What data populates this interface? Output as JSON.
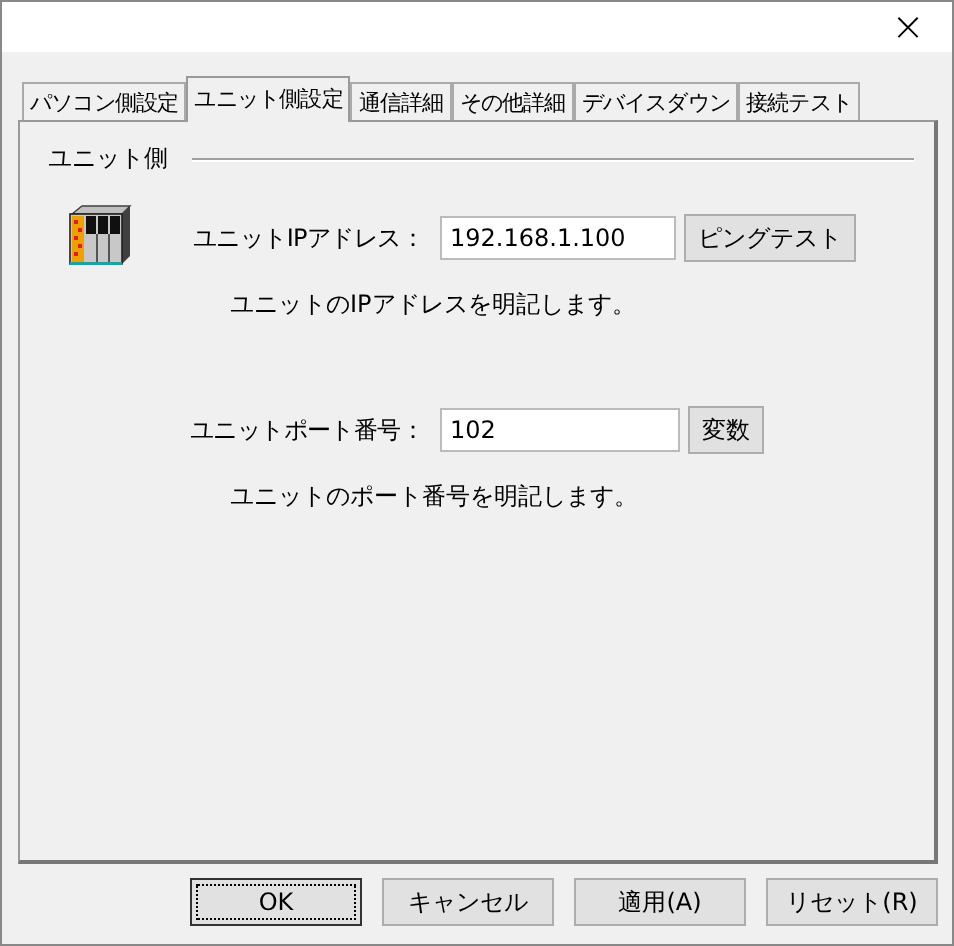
{
  "window": {
    "close": "×"
  },
  "tabs": [
    {
      "label": "パソコン側設定",
      "selected": false
    },
    {
      "label": "ユニット側設定",
      "selected": true
    },
    {
      "label": "通信詳細",
      "selected": false
    },
    {
      "label": "その他詳細",
      "selected": false
    },
    {
      "label": "デバイスダウン",
      "selected": false
    },
    {
      "label": "接続テスト",
      "selected": false
    }
  ],
  "group": {
    "title": "ユニット側"
  },
  "fields": [
    {
      "label": "ユニットIPアドレス：",
      "value": "192.168.1.100",
      "button": "ピングテスト",
      "hint": "ユニットのIPアドレスを明記します。"
    },
    {
      "label": "ユニットポート番号：",
      "value": "102",
      "button": "変数",
      "hint": "ユニットのポート番号を明記します。"
    }
  ],
  "buttons": [
    {
      "label": "OK",
      "selected": true
    },
    {
      "label": "キャンセル",
      "selected": false
    },
    {
      "label": "適用(A)",
      "selected": false
    },
    {
      "label": "リセット(R)",
      "selected": false
    }
  ]
}
